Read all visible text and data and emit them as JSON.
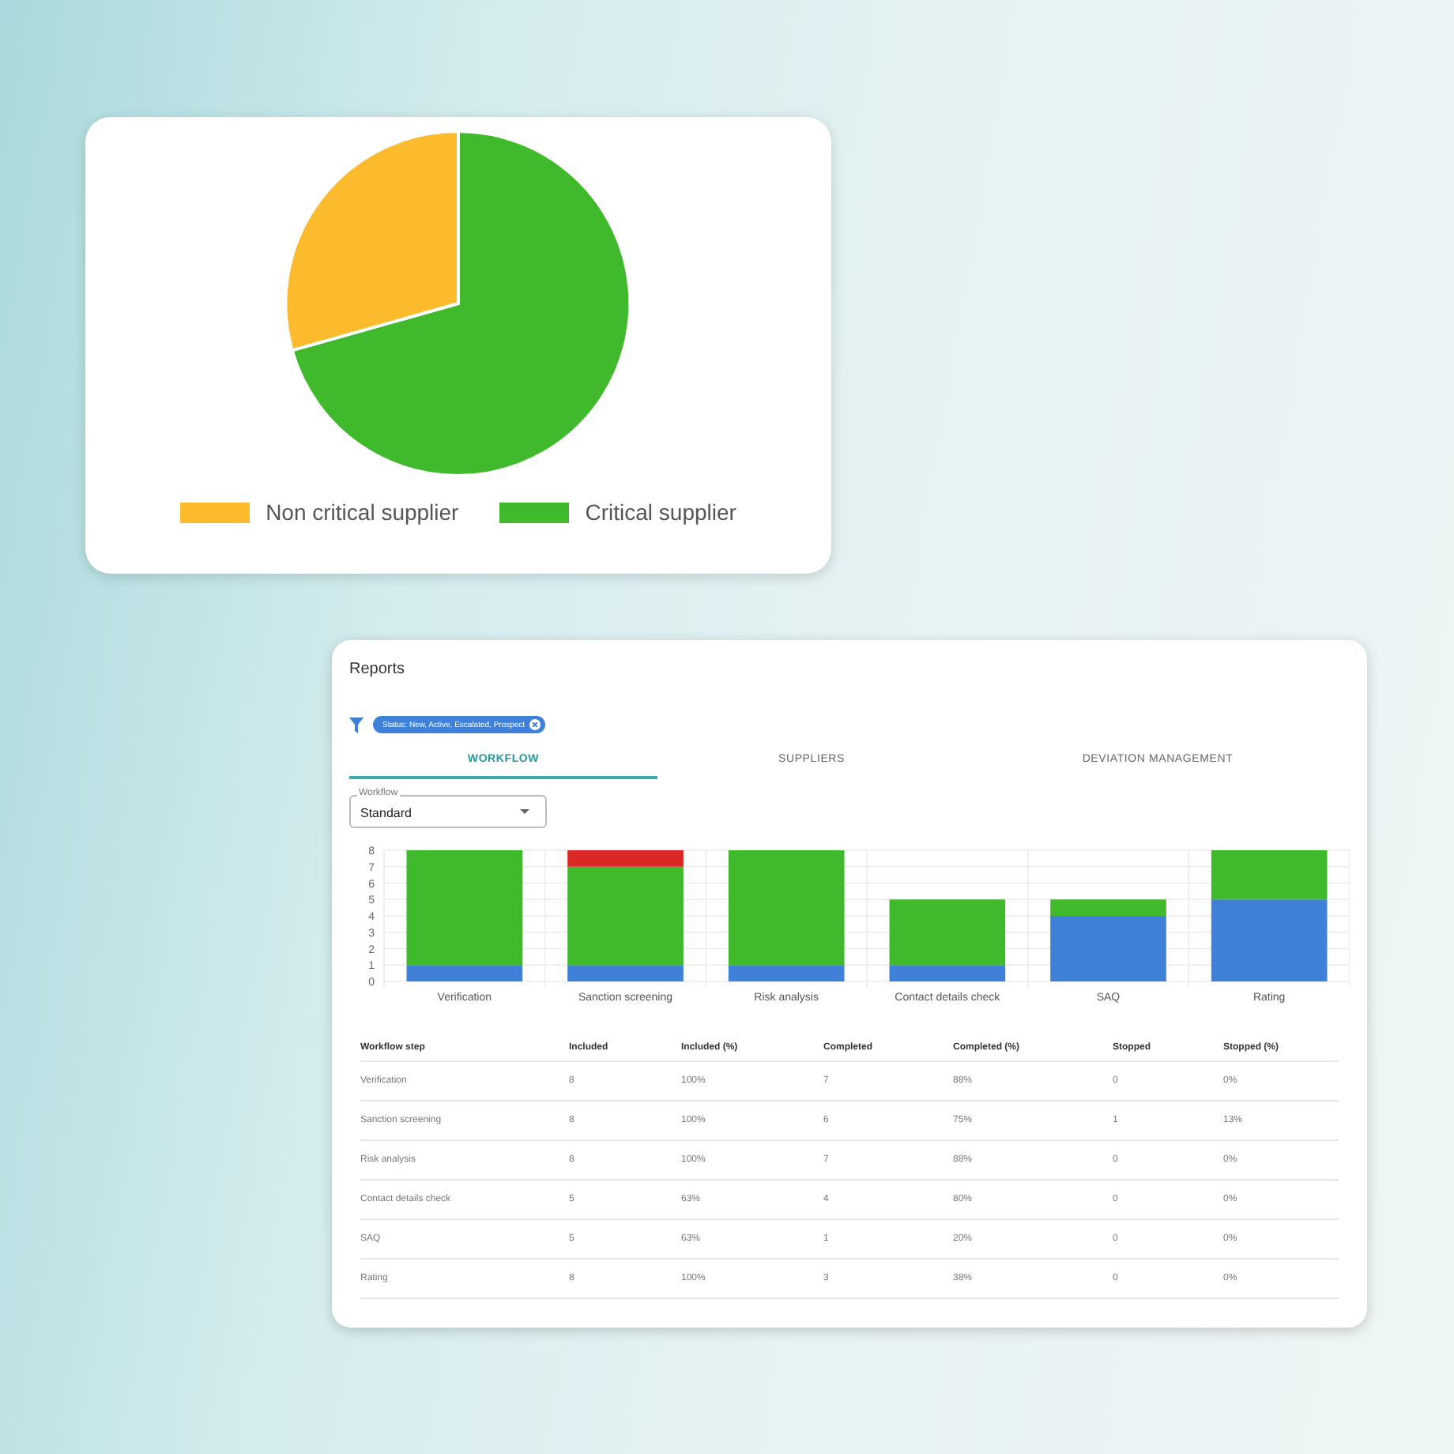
{
  "pie_card": {
    "legend": [
      {
        "label": "Non critical supplier",
        "color": "#fbbb2d"
      },
      {
        "label": "Critical supplier",
        "color": "#41b92c"
      }
    ]
  },
  "reports": {
    "title": "Reports",
    "filter": {
      "chip": "Status: New, Active, Escalated, Prospect"
    },
    "tabs": [
      {
        "label": "WORKFLOW",
        "selected": true
      },
      {
        "label": "SUPPLIERS",
        "selected": false
      },
      {
        "label": "DEVIATION MANAGEMENT",
        "selected": false
      }
    ],
    "workflow_select": {
      "label": "Workflow",
      "value": "Standard"
    },
    "chart_data": {
      "type": "bar",
      "stacked": true,
      "grid": true,
      "categories": [
        "Verification",
        "Sanction screening",
        "Risk analysis",
        "Contact details check",
        "SAQ",
        "Rating"
      ],
      "ylim": [
        0,
        8
      ],
      "yticks": [
        0,
        1,
        2,
        3,
        4,
        5,
        6,
        7,
        8
      ],
      "series": [
        {
          "color": "#3f80d8",
          "values": [
            1,
            1,
            1,
            1,
            4,
            5
          ]
        },
        {
          "color": "#41b92c",
          "values": [
            7,
            6,
            7,
            4,
            1,
            3
          ]
        },
        {
          "color": "#dd2727",
          "values": [
            0,
            1,
            0,
            0,
            0,
            0
          ]
        }
      ]
    },
    "table": {
      "columns": [
        "Workflow step",
        "Included",
        "Included (%)",
        "Completed",
        "Completed (%)",
        "Stopped",
        "Stopped (%)"
      ],
      "rows": [
        [
          "Verification",
          "8",
          "100%",
          "7",
          "88%",
          "0",
          "0%"
        ],
        [
          "Sanction screening",
          "8",
          "100%",
          "6",
          "75%",
          "1",
          "13%"
        ],
        [
          "Risk analysis",
          "8",
          "100%",
          "7",
          "88%",
          "0",
          "0%"
        ],
        [
          "Contact details check",
          "5",
          "63%",
          "4",
          "80%",
          "0",
          "0%"
        ],
        [
          "SAQ",
          "5",
          "63%",
          "1",
          "20%",
          "0",
          "0%"
        ],
        [
          "Rating",
          "8",
          "100%",
          "3",
          "38%",
          "0",
          "0%"
        ]
      ]
    }
  }
}
